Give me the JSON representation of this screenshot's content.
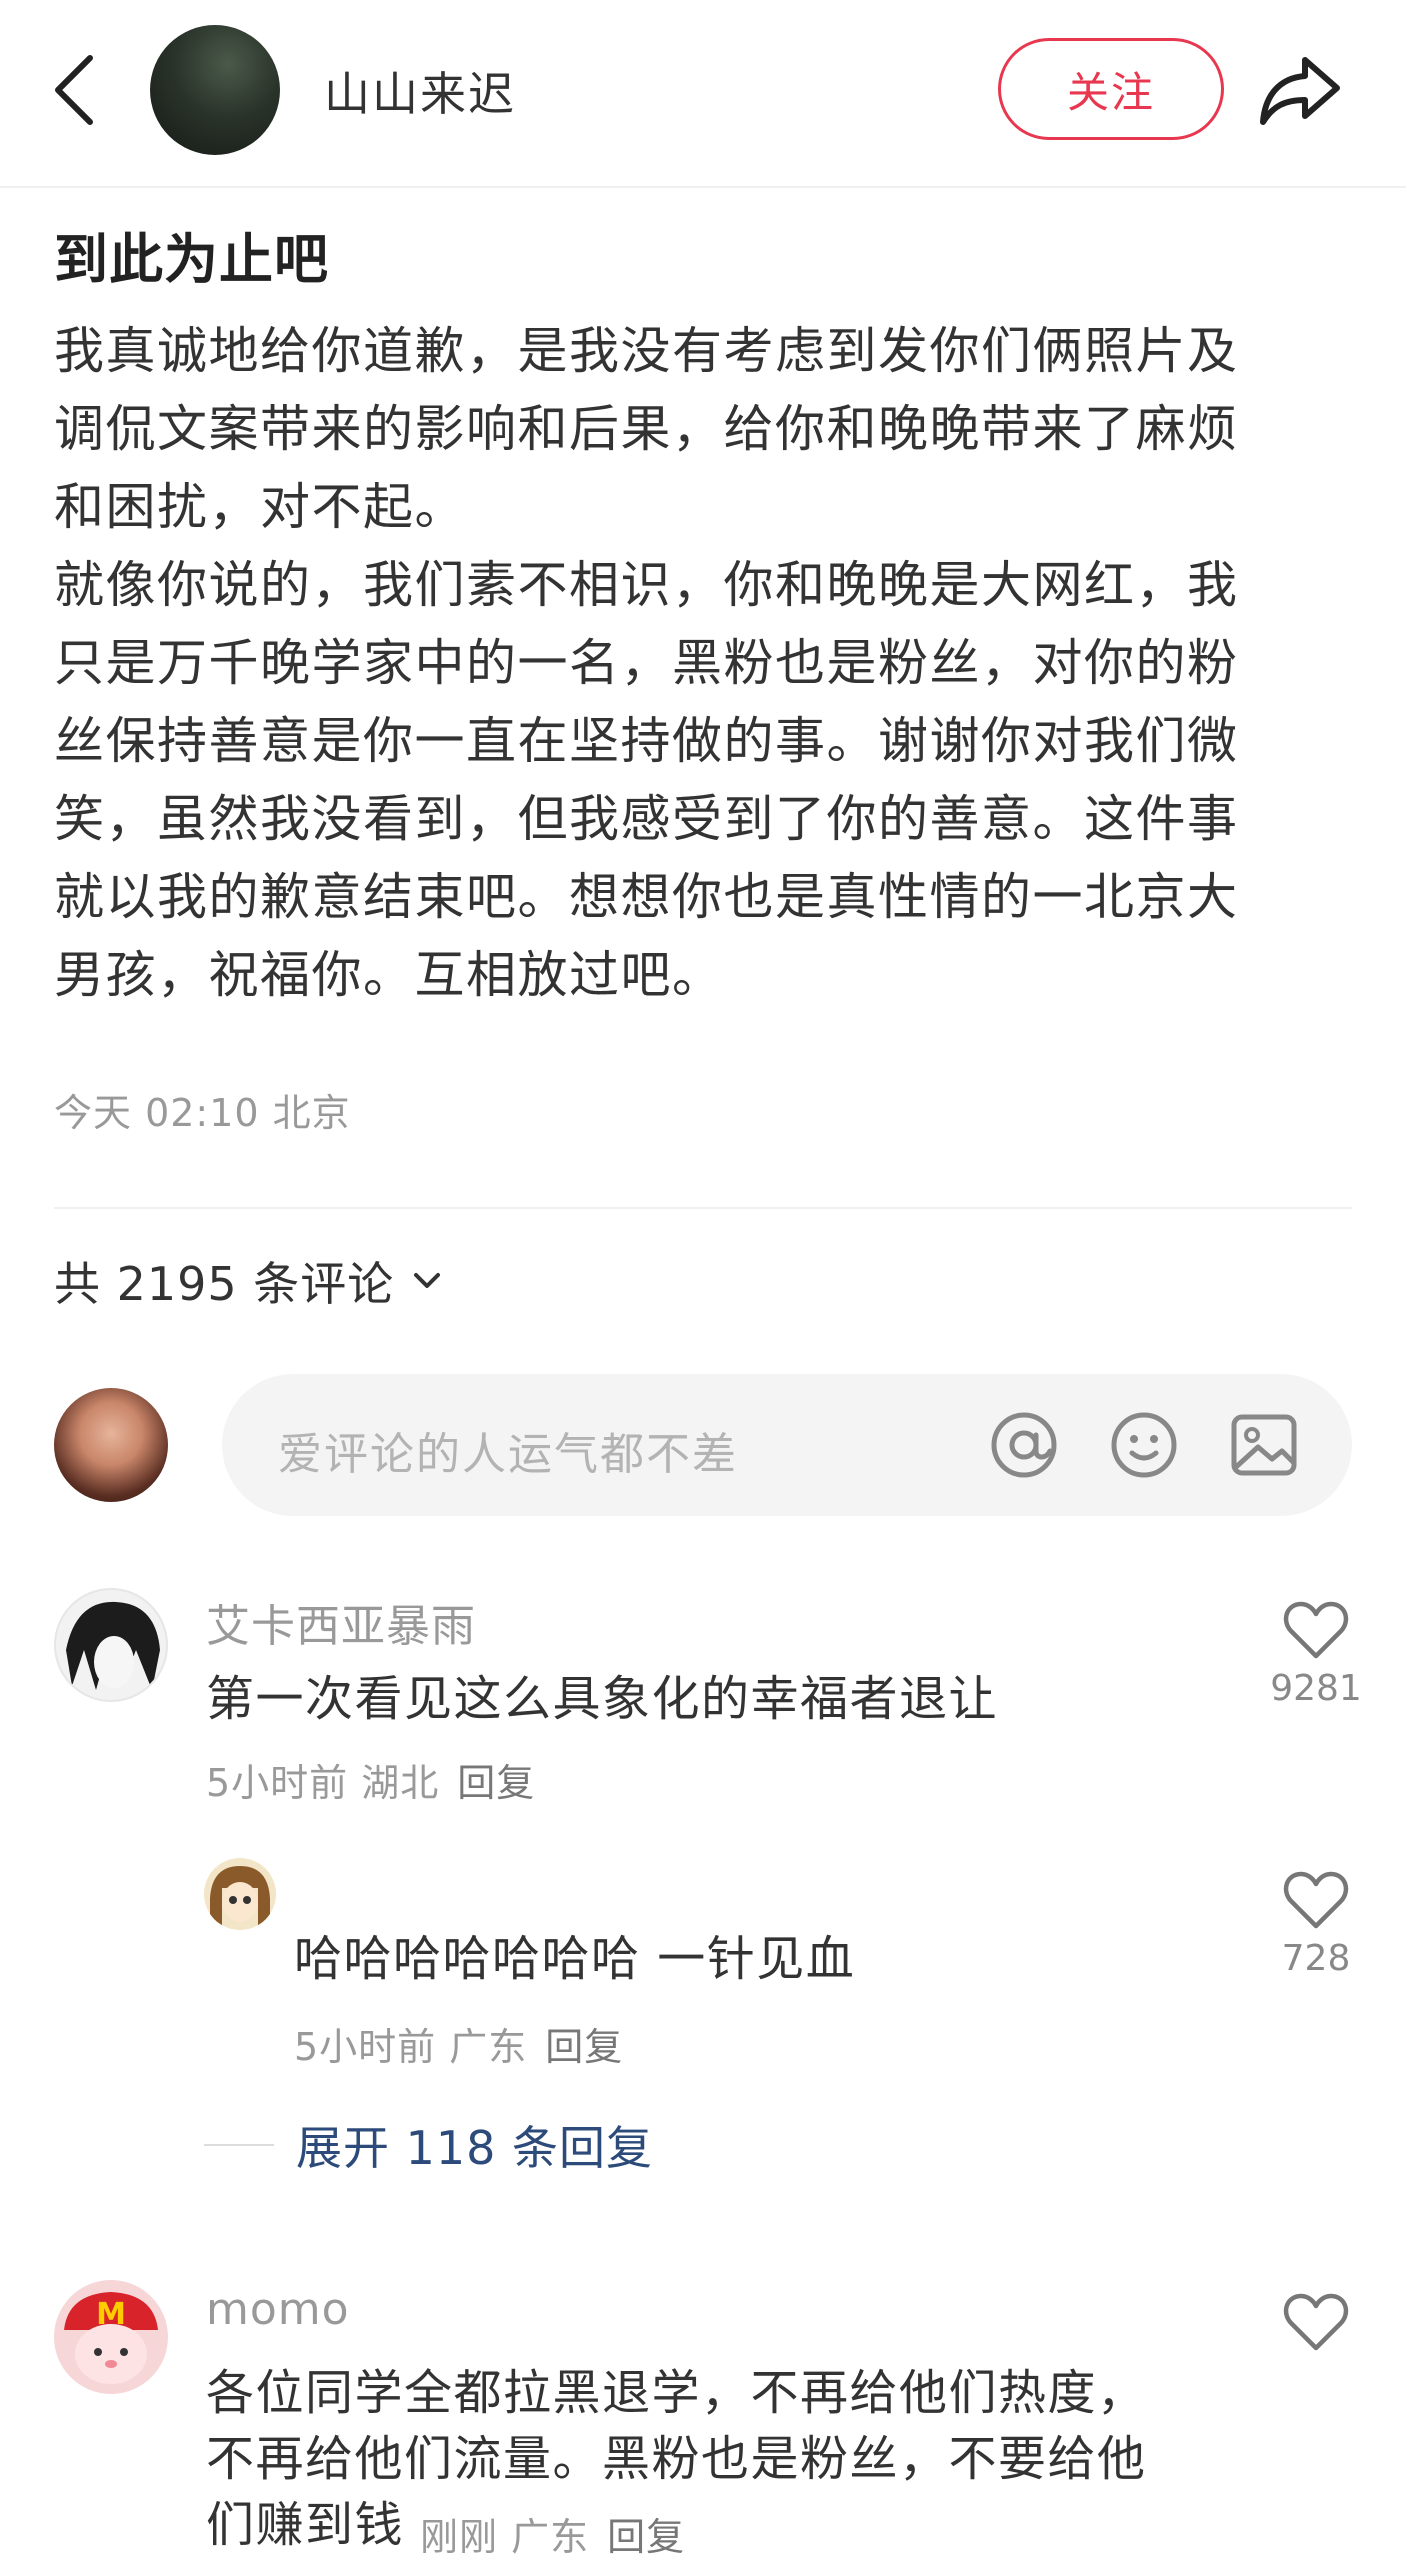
{
  "header": {
    "author_name": "山山来迟",
    "follow_label": "关注"
  },
  "post": {
    "title": "到此为止吧",
    "lines": [
      "我真诚地给你道歉，是我没有考虑到发你们俩照片及",
      "调侃文案带来的影响和后果，给你和晚晚带来了麻烦",
      "和困扰，对不起。",
      "就像你说的，我们素不相识，你和晚晚是大网红，我",
      "只是万千晚学家中的一名，黑粉也是粉丝，对你的粉",
      "丝保持善意是你一直在坚持做的事。谢谢你对我们微",
      "笑，虽然我没看到，但我感受到了你的善意。这件事",
      "就以我的歉意结束吧。想想你也是真性情的一北京大",
      "男孩，祝福你。互相放过吧。"
    ],
    "meta": "今天 02:10 北京"
  },
  "comments_header": {
    "label": "共 2195 条评论"
  },
  "comment_input": {
    "placeholder": "爱评论的人运气都不差"
  },
  "comments": [
    {
      "name": "艾卡西亚暴雨",
      "text": "第一次看见这么具象化的幸福者退让",
      "time": "5小时前 湖北",
      "reply_label": "回复",
      "likes": "9281"
    },
    {
      "name": "",
      "text": "哈哈哈哈哈哈哈 一针见血",
      "time": "5小时前 广东",
      "reply_label": "回复",
      "likes": "728"
    },
    {
      "name": "momo",
      "text_lines": [
        "各位同学全都拉黑退学，不再给他们热度，",
        "不再给他们流量。黑粉也是粉丝，不要给他",
        "们赚到钱"
      ],
      "time": "刚刚 广东",
      "reply_label": "回复",
      "likes": ""
    }
  ],
  "expand_replies": {
    "label": "展开 118 条回复"
  },
  "colors": {
    "accent_red": "#e8384f",
    "link_blue": "#2c4a7a"
  }
}
